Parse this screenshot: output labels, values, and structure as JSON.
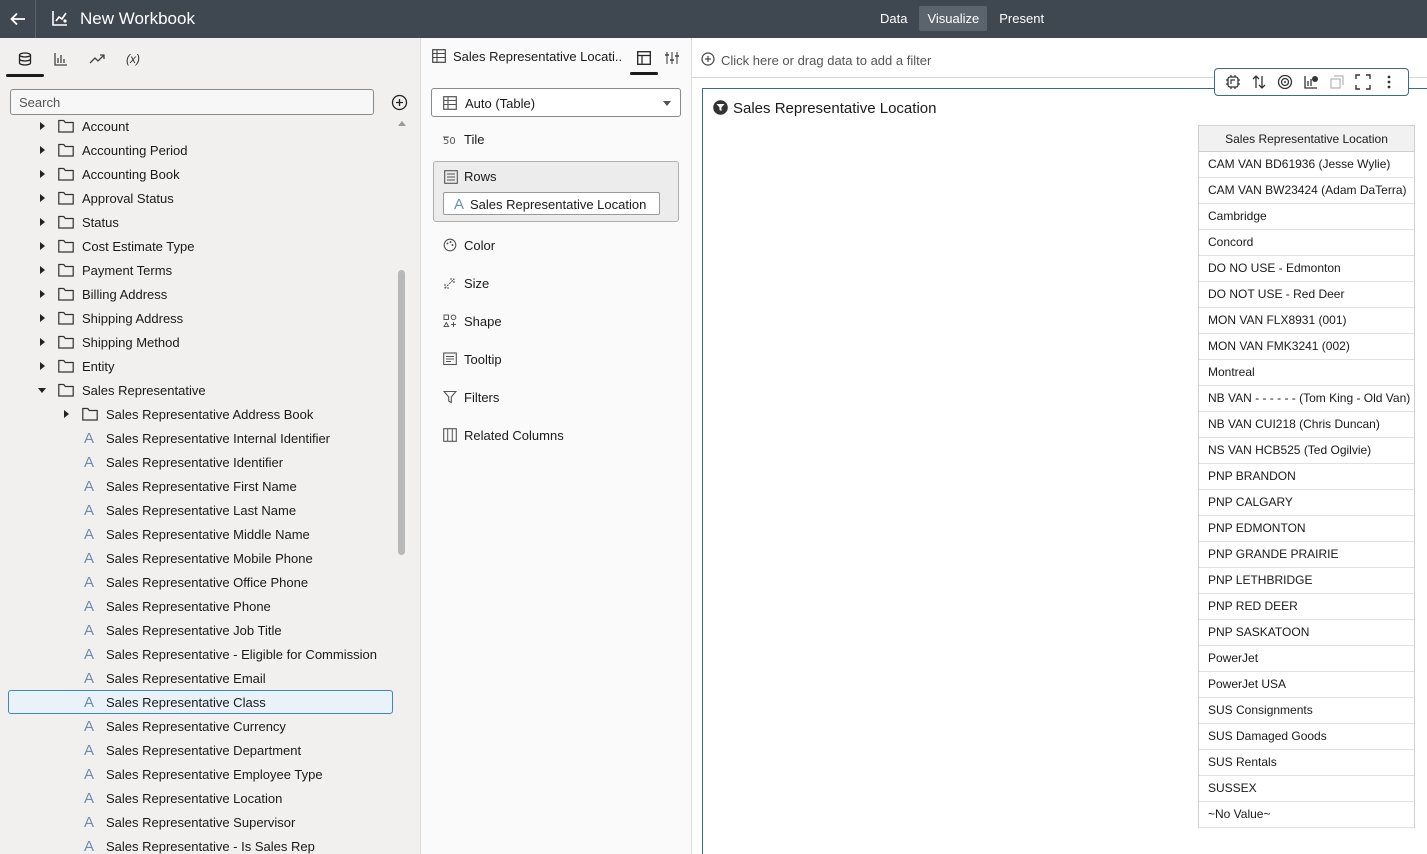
{
  "header": {
    "title": "New Workbook",
    "modes": [
      {
        "label": "Data",
        "active": false
      },
      {
        "label": "Visualize",
        "active": true
      },
      {
        "label": "Present",
        "active": false
      }
    ]
  },
  "left_panel": {
    "tabs": [
      {
        "icon": "database-icon",
        "active": true
      },
      {
        "icon": "bar-chart-icon",
        "active": false
      },
      {
        "icon": "trend-icon",
        "active": false
      },
      {
        "icon": "calculation-icon",
        "label": "(x)",
        "active": false
      }
    ],
    "search": {
      "placeholder": "Search",
      "value": ""
    },
    "tree": [
      {
        "label": "Account",
        "type": "folder",
        "level": 0,
        "expanded": false
      },
      {
        "label": "Accounting Period",
        "type": "folder",
        "level": 0,
        "expanded": false
      },
      {
        "label": "Accounting Book",
        "type": "folder",
        "level": 0,
        "expanded": false
      },
      {
        "label": "Approval Status",
        "type": "folder",
        "level": 0,
        "expanded": false
      },
      {
        "label": "Status",
        "type": "folder",
        "level": 0,
        "expanded": false
      },
      {
        "label": "Cost Estimate Type",
        "type": "folder",
        "level": 0,
        "expanded": false
      },
      {
        "label": "Payment Terms",
        "type": "folder",
        "level": 0,
        "expanded": false
      },
      {
        "label": "Billing Address",
        "type": "folder",
        "level": 0,
        "expanded": false
      },
      {
        "label": "Shipping Address",
        "type": "folder",
        "level": 0,
        "expanded": false
      },
      {
        "label": "Shipping Method",
        "type": "folder",
        "level": 0,
        "expanded": false
      },
      {
        "label": "Entity",
        "type": "folder",
        "level": 0,
        "expanded": false
      },
      {
        "label": "Sales Representative",
        "type": "folder",
        "level": 0,
        "expanded": true
      },
      {
        "label": "Sales Representative Address Book",
        "type": "folder",
        "level": 1,
        "expanded": false
      },
      {
        "label": "Sales Representative Internal Identifier",
        "type": "attribute",
        "level": 1
      },
      {
        "label": "Sales Representative Identifier",
        "type": "attribute",
        "level": 1
      },
      {
        "label": "Sales Representative First Name",
        "type": "attribute",
        "level": 1
      },
      {
        "label": "Sales Representative Last Name",
        "type": "attribute",
        "level": 1
      },
      {
        "label": "Sales Representative Middle Name",
        "type": "attribute",
        "level": 1
      },
      {
        "label": "Sales Representative Mobile Phone",
        "type": "attribute",
        "level": 1
      },
      {
        "label": "Sales Representative Office Phone",
        "type": "attribute",
        "level": 1
      },
      {
        "label": "Sales Representative Phone",
        "type": "attribute",
        "level": 1
      },
      {
        "label": "Sales Representative Job Title",
        "type": "attribute",
        "level": 1
      },
      {
        "label": "Sales Representative - Eligible for Commission",
        "type": "attribute",
        "level": 1
      },
      {
        "label": "Sales Representative Email",
        "type": "attribute",
        "level": 1
      },
      {
        "label": "Sales Representative Class",
        "type": "attribute",
        "level": 1,
        "selected": true
      },
      {
        "label": "Sales Representative Currency",
        "type": "attribute",
        "level": 1
      },
      {
        "label": "Sales Representative Department",
        "type": "attribute",
        "level": 1
      },
      {
        "label": "Sales Representative Employee Type",
        "type": "attribute",
        "level": 1
      },
      {
        "label": "Sales Representative Location",
        "type": "attribute",
        "level": 1
      },
      {
        "label": "Sales Representative Supervisor",
        "type": "attribute",
        "level": 1
      },
      {
        "label": "Sales Representative - Is Sales Rep",
        "type": "attribute",
        "level": 1
      }
    ]
  },
  "grammar_panel": {
    "tab_title": "Sales Representative Locati...",
    "viz_type": "Auto (Table)",
    "tile_label": "Tile",
    "rows_label": "Rows",
    "rows_pill": "Sales Representative Location",
    "items_after": [
      {
        "label": "Color",
        "icon": "palette-icon"
      },
      {
        "label": "Size",
        "icon": "resize-icon"
      },
      {
        "label": "Shape",
        "icon": "shapes-icon"
      },
      {
        "label": "Tooltip",
        "icon": "tooltip-icon"
      },
      {
        "label": "Filters",
        "icon": "funnel-icon"
      },
      {
        "label": "Related Columns",
        "icon": "columns-icon"
      }
    ]
  },
  "canvas": {
    "filter_placeholder": "Click here or drag data to add a filter",
    "viz_title": "Sales Representative Location",
    "toolbar_icons": [
      "auto-insights-icon",
      "sort-icon",
      "target-icon",
      "chart-add-icon",
      "duplicate-icon",
      "maximize-icon",
      "more-icon"
    ],
    "table": {
      "header": "Sales Representative Location",
      "rows": [
        "CAM VAN BD61936 (Jesse Wylie)",
        "CAM VAN BW23424 (Adam DaTerra)",
        "Cambridge",
        "Concord",
        "DO NO USE - Edmonton",
        "DO NOT USE - Red Deer",
        "MON VAN FLX8931 (001)",
        "MON VAN FMK3241 (002)",
        "Montreal",
        "NB VAN - - - - - - (Tom King - Old Van)",
        "NB VAN CUI218 (Chris Duncan)",
        "NS VAN HCB525 (Ted Ogilvie)",
        "PNP BRANDON",
        "PNP CALGARY",
        "PNP EDMONTON",
        "PNP GRANDE PRAIRIE",
        "PNP LETHBRIDGE",
        "PNP RED DEER",
        "PNP SASKATOON",
        "PowerJet",
        "PowerJet USA",
        "SUS Consignments",
        "SUS Damaged Goods",
        "SUS Rentals",
        "SUSSEX",
        "~No Value~"
      ]
    }
  }
}
